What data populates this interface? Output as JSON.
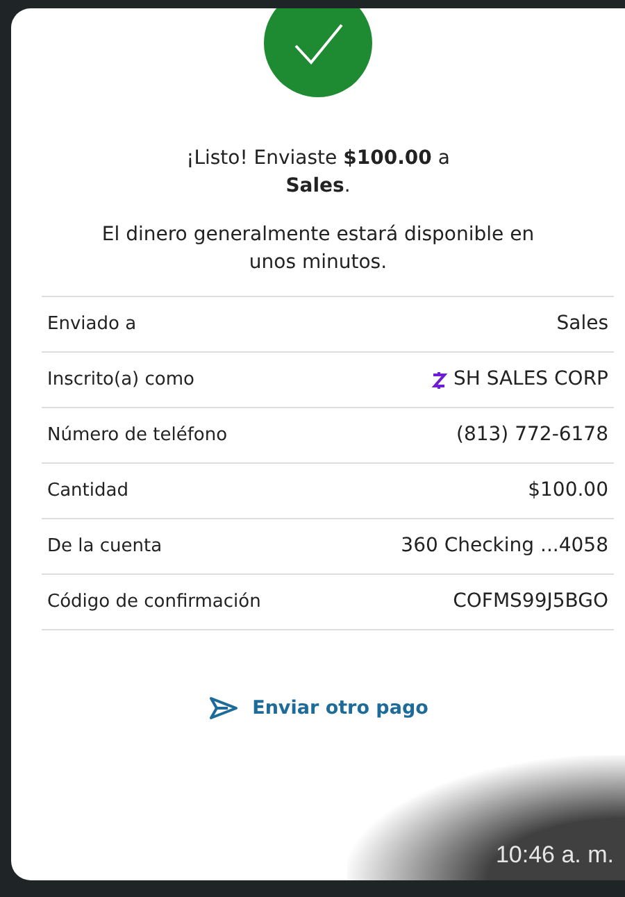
{
  "confirmation": {
    "headline": "¡Listo! Enviaste **$100.00** a **Sales**.",
    "message": "El dinero generalmente estará disponible en unos minutos."
  },
  "details": [
    {
      "label": "Enviado a",
      "value": "Sales",
      "kind": "plain"
    },
    {
      "label": "Inscrito(a) como",
      "value": "SH SALES CORP",
      "kind": "zelle"
    },
    {
      "label": "Número de teléfono",
      "value": "(813) 772-6178",
      "kind": "plain"
    },
    {
      "label": "Cantidad",
      "value": "$100.00",
      "kind": "plain"
    },
    {
      "label": "De la cuenta",
      "value": "360 Checking ...4058",
      "kind": "plain"
    },
    {
      "label": "Código de confirmación",
      "value": "COFMS99J5BGO",
      "kind": "plain"
    }
  ],
  "action": {
    "label": "Enviar otro pago"
  },
  "timestamp": "10:46 a. m."
}
